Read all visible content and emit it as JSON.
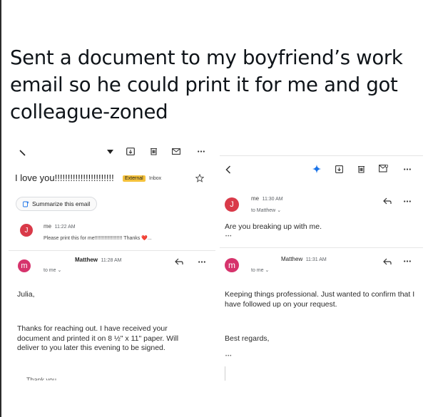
{
  "caption": "Sent a document to my boyfriend’s work email so he could print it for me and got colleague-zoned",
  "left": {
    "subject": "I love you!!!!!!!!!!!!!!!!!!!!!!!",
    "external_label": "External",
    "inbox_label": "Inbox",
    "summarize_label": "Summarize this email",
    "msg1": {
      "avatar": "J",
      "sender": "me",
      "time": "11:22 AM",
      "snippet": "Please print this for me!!!!!!!!!!!!!!!!!!!! Thanks ❤️..."
    },
    "msg2": {
      "avatar": "m",
      "sender": "Matthew",
      "time": "11:28 AM",
      "to": "to me"
    },
    "greeting": "Julia,",
    "body": "Thanks for reaching out. I have received your document and printed it on 8 ½\" x 11\" paper. Will deliver to you later this evening to be signed.",
    "closing": "Thank you"
  },
  "right": {
    "msg1": {
      "avatar": "J",
      "sender": "me",
      "time": "11:30 AM",
      "to": "to Matthew"
    },
    "text1": "Are you breaking up with me.",
    "ellipsis": "•••",
    "msg2": {
      "avatar": "m",
      "sender": "Matthew",
      "time": "11:31 AM",
      "to": "to me"
    },
    "body": "Keeping things professional. Just wanted to confirm that I have followed up on your request.",
    "closing": "Best regards,"
  },
  "icons": {
    "back": "back-arrow-icon",
    "archive": "archive-icon",
    "delete": "trash-icon",
    "mail": "mark-unread-icon",
    "more": "more-dots-icon",
    "reply": "reply-icon",
    "star": "star-icon",
    "sparkle": "gemini-sparkle-icon"
  },
  "colors": {
    "avatar_j": "#d93a49",
    "avatar_m": "#d6336c",
    "external_label": "#f5c23c"
  }
}
